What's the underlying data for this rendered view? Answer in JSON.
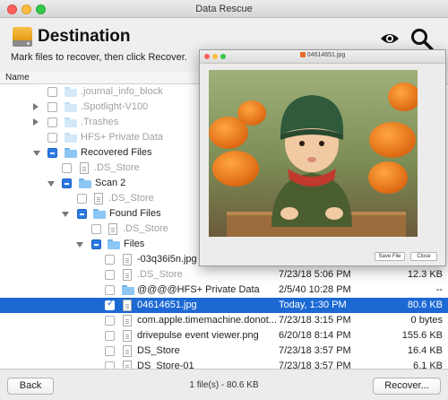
{
  "window": {
    "title": "Data Rescue"
  },
  "header": {
    "title": "Destination",
    "subtitle": "Mark files to recover, then click Recover."
  },
  "columns": {
    "name": "Name"
  },
  "rows": [
    {
      "label": ".journal_info_block",
      "date": "",
      "size": ""
    },
    {
      "label": ".Spotlight-V100",
      "date": "",
      "size": ""
    },
    {
      "label": ".Trashes",
      "date": "",
      "size": ""
    },
    {
      "label": "HFS+ Private Data",
      "date": "",
      "size": ""
    },
    {
      "label": "Recovered Files",
      "date": "",
      "size": ""
    },
    {
      "label": ".DS_Store",
      "date": "",
      "size": ""
    },
    {
      "label": "Scan 2",
      "date": "",
      "size": ""
    },
    {
      "label": ".DS_Store",
      "date": "",
      "size": ""
    },
    {
      "label": "Found Files",
      "date": "",
      "size": ""
    },
    {
      "label": ".DS_Store",
      "date": "",
      "size": ""
    },
    {
      "label": "Files",
      "date": "",
      "size": ""
    },
    {
      "label": "-03q36i5n.jpg",
      "date": "",
      "size": ""
    },
    {
      "label": ".DS_Store",
      "date": "7/23/18 5:06 PM",
      "size": "12.3 KB"
    },
    {
      "label": "@@@@HFS+ Private Data",
      "date": "2/5/40 10:28 PM",
      "size": "--"
    },
    {
      "label": "04614651.jpg",
      "date": "Today, 1:30 PM",
      "size": "80.6 KB"
    },
    {
      "label": "com.apple.timemachine.donot...",
      "date": "7/23/18 3:15 PM",
      "size": "0 bytes"
    },
    {
      "label": "drivepulse event viewer.png",
      "date": "6/20/18 8:14 PM",
      "size": "155.6 KB"
    },
    {
      "label": "DS_Store",
      "date": "7/23/18 3:57 PM",
      "size": "16.4 KB"
    },
    {
      "label": "DS_Store-01",
      "date": "7/23/18 3:57 PM",
      "size": "6.1 KB"
    }
  ],
  "preview": {
    "title": "04614651.jpg",
    "save_label": "Save File",
    "close_label": "Close"
  },
  "footer": {
    "back_label": "Back",
    "status": "1 file(s) - 80.6 KB",
    "recover_label": "Recover..."
  },
  "colors": {
    "selection": "#1c69d4",
    "accent": "#2a7ae2"
  }
}
